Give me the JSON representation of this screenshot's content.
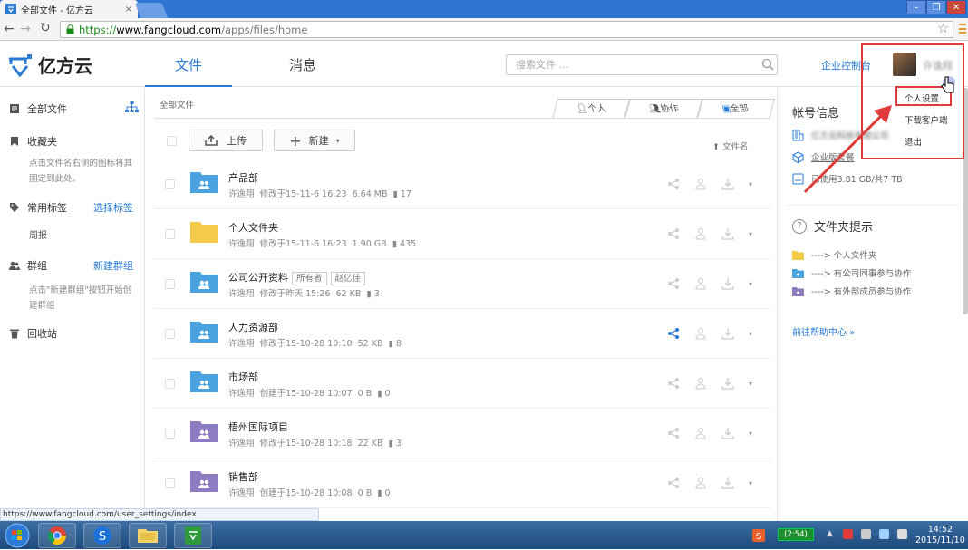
{
  "browser": {
    "tab_title": "全部文件 - 亿方云",
    "url_scheme": "https://",
    "url_host": "www.fangcloud.com",
    "url_path": "/apps/files/home",
    "status_url": "https://www.fangcloud.com/user_settings/index",
    "window_buttons": [
      "–",
      "❐",
      "✕"
    ]
  },
  "header": {
    "brand": "亿方云",
    "nav": [
      "文件",
      "消息"
    ],
    "search_placeholder": "搜索文件 ...",
    "enterprise_console": "企业控制台",
    "username": "许逸翔"
  },
  "user_menu": {
    "items": [
      "个人设置",
      "下载客户端",
      "退出"
    ]
  },
  "sidebar": {
    "all_files": "全部文件",
    "favorites": "收藏夹",
    "favorites_hint": "点击文件名右侧的图标将其固定到此处。",
    "tags": "常用标签",
    "tags_action": "选择标签",
    "tag_item": "周报",
    "groups": "群组",
    "groups_action": "新建群组",
    "groups_hint": "点击\"新建群组\"按钮开始创建群组",
    "trash": "回收站"
  },
  "main": {
    "breadcrumb": "全部文件",
    "view_tabs": [
      "个人",
      "协作",
      "全部"
    ],
    "upload_label": "上传",
    "new_label": "新建",
    "sort_label": "文件名",
    "files": [
      {
        "name": "产品部",
        "owner": "许逸翔",
        "action": "修改于15-11-6 16:23",
        "size": "6.64 MB",
        "count": "17",
        "kind": "company",
        "tags": []
      },
      {
        "name": "个人文件夹",
        "owner": "许逸翔",
        "action": "修改于15-11-6 16:23",
        "size": "1.90 GB",
        "count": "435",
        "kind": "personal",
        "tags": []
      },
      {
        "name": "公司公开资料",
        "owner": "许逸翔",
        "action": "修改于昨天 15:26",
        "size": "62 KB",
        "count": "3",
        "kind": "company",
        "tags": [
          "所有者",
          "赵亿佳"
        ]
      },
      {
        "name": "人力资源部",
        "owner": "许逸翔",
        "action": "修改于15-10-28 10:10",
        "size": "52 KB",
        "count": "8",
        "kind": "company",
        "tags": []
      },
      {
        "name": "市场部",
        "owner": "许逸翔",
        "action": "创建于15-10-28 10:07",
        "size": "0 B",
        "count": "0",
        "kind": "company",
        "tags": []
      },
      {
        "name": "梧州国际项目",
        "owner": "许逸翔",
        "action": "修改于15-10-28 10:18",
        "size": "22 KB",
        "count": "3",
        "kind": "external",
        "tags": []
      },
      {
        "name": "销售部",
        "owner": "许逸翔",
        "action": "创建于15-10-28 10:08",
        "size": "0 B",
        "count": "0",
        "kind": "external",
        "tags": []
      }
    ]
  },
  "right_panel": {
    "account_title": "帐号信息",
    "company": "亿方云科技有限公司",
    "plan": "企业版套餐",
    "storage": "已使用3.81 GB/共7 TB",
    "folder_tips_title": "文件夹提示",
    "tips": [
      "----> 个人文件夹",
      "----> 有公司同事参与协作",
      "----> 有外部成员参与协作"
    ],
    "help_link": "前往帮助中心 »"
  },
  "taskbar": {
    "time": "14:52",
    "date": "2015/11/10",
    "battery": "(2:54)"
  },
  "colors": {
    "accent": "#2a7bd4",
    "annotation": "#e03b3b",
    "folder_company": "#4aa3df",
    "folder_personal": "#f5c94a",
    "folder_external": "#8e7cc3"
  }
}
